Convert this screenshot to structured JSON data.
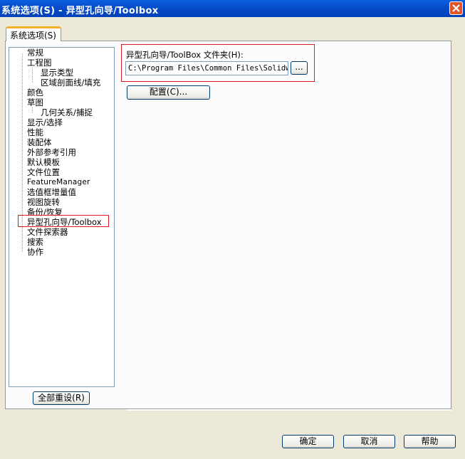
{
  "window": {
    "title": "系统选项(S) - 异型孔向导/Toolbox"
  },
  "tab": {
    "label": "系统选项(S)"
  },
  "tree": {
    "items": [
      "常规",
      "工程图",
      "显示类型",
      "区域剖面线/填充",
      "颜色",
      "草图",
      "几何关系/捕捉",
      "显示/选择",
      "性能",
      "装配体",
      "外部参考引用",
      "默认模板",
      "文件位置",
      "FeatureManager",
      "选值框增量值",
      "视图旋转",
      "备份/恢复",
      "异型孔向导/Toolbox",
      "文件探索器",
      "搜索",
      "协作"
    ],
    "selected": "异型孔向导/Toolbox"
  },
  "reset_button": "全部重设(R)",
  "toolbox": {
    "folder_label": "异型孔向导/ToolBox 文件夹(H):",
    "folder_path": "C:\\Program Files\\Common Files\\Solidworks Data",
    "browse_label": "...",
    "configure_label": "配置(C)..."
  },
  "footer": {
    "ok": "确定",
    "cancel": "取消",
    "help": "帮助"
  },
  "colors": {
    "title_bar": "#0548c4",
    "highlight_box": "#e0191e",
    "tab_accent": "#f4b12c"
  },
  "icons": [
    "close-icon"
  ]
}
